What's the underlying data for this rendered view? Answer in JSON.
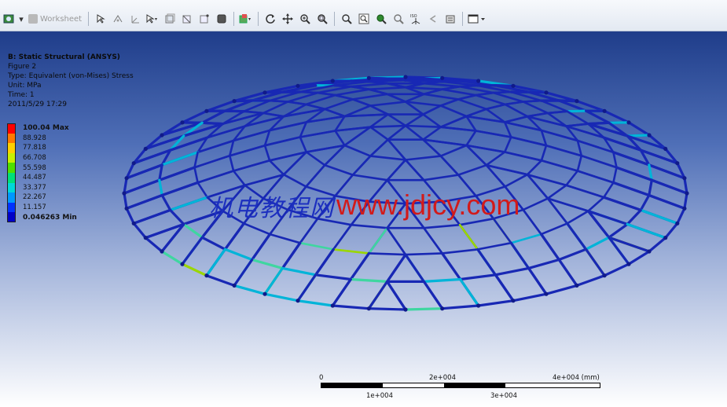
{
  "toolbar": {
    "worksheet_label": "Worksheet",
    "icons_left": [
      "graphics-icon",
      "dropdown-arrow-icon"
    ],
    "icons_main": [
      "select-icon",
      "label-icon",
      "coordinate-icon",
      "select-mode-icon",
      "face-select-icon",
      "edge-select-icon",
      "vertex-select-icon",
      "body-select-icon",
      "display-style-icon",
      "rotate-icon",
      "pan-icon",
      "zoom-icon",
      "box-zoom-icon",
      "zoom-fit-icon",
      "zoom-window-icon",
      "magnify-icon",
      "zoom-out-icon",
      "iso-view-icon",
      "previous-view-icon",
      "next-view-icon",
      "viewport-icon"
    ],
    "iso_label": "ISO"
  },
  "info": {
    "title": "B: Static Structural (ANSYS)",
    "figure": "Figure 2",
    "type": "Type: Equivalent (von-Mises) Stress",
    "unit": "Unit: MPa",
    "time": "Time: 1",
    "date": "2011/5/29 17:29"
  },
  "legend": {
    "entries": [
      {
        "label": "100.04 Max",
        "color": "#ff0000",
        "strong": true
      },
      {
        "label": "88.928",
        "color": "#ff7a00",
        "strong": false
      },
      {
        "label": "77.818",
        "color": "#ffd000",
        "strong": false
      },
      {
        "label": "66.708",
        "color": "#c8f000",
        "strong": false
      },
      {
        "label": "55.598",
        "color": "#4fe000",
        "strong": false
      },
      {
        "label": "44.487",
        "color": "#00e07a",
        "strong": false
      },
      {
        "label": "33.377",
        "color": "#00d8d8",
        "strong": false
      },
      {
        "label": "22.267",
        "color": "#0098ff",
        "strong": false
      },
      {
        "label": "11.157",
        "color": "#0032ff",
        "strong": false
      },
      {
        "label": "0.046263 Min",
        "color": "#0000c8",
        "strong": true
      }
    ]
  },
  "watermark": {
    "chinese": "机电教程网",
    "url": "www.jdjcy.com"
  },
  "scale": {
    "unit": "(mm)",
    "top_ticks": [
      "0",
      "2e+004",
      "4e+004 (mm)"
    ],
    "bottom_ticks": [
      "1e+004",
      "3e+004"
    ]
  },
  "model": {
    "primary_color": "#1828b4",
    "accent_colors": [
      "#00b4d8",
      "#3fd6a0",
      "#9ad600"
    ]
  }
}
